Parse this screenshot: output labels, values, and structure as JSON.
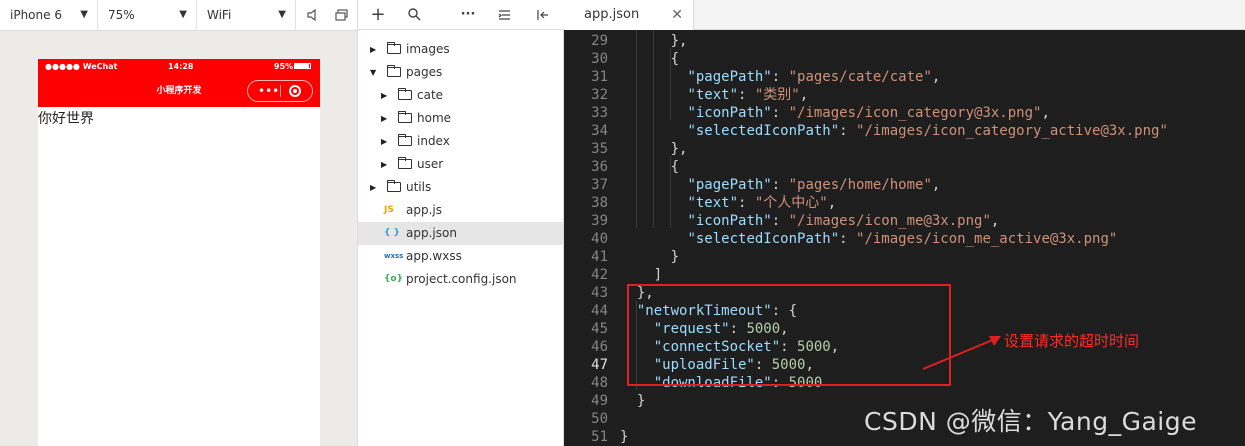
{
  "simulator": {
    "device": "iPhone 6",
    "zoom": "75%",
    "network": "WiFi",
    "status_carrier": "●●●●● WeChat",
    "status_time": "14:28",
    "status_battery": "95%",
    "battery_level": 0.95,
    "nav_title": "小程序开发",
    "page_text": "你好世界",
    "nav_color": "#ff0000"
  },
  "explorer": {
    "tree": [
      {
        "name": "images",
        "type": "folder",
        "expanded": false,
        "depth": 0
      },
      {
        "name": "pages",
        "type": "folder",
        "expanded": true,
        "depth": 0
      },
      {
        "name": "cate",
        "type": "folder",
        "expanded": false,
        "depth": 1
      },
      {
        "name": "home",
        "type": "folder",
        "expanded": false,
        "depth": 1
      },
      {
        "name": "index",
        "type": "folder",
        "expanded": false,
        "depth": 1
      },
      {
        "name": "user",
        "type": "folder",
        "expanded": false,
        "depth": 1
      },
      {
        "name": "utils",
        "type": "folder",
        "expanded": false,
        "depth": 0
      },
      {
        "name": "app.js",
        "type": "js",
        "icon": "JS",
        "depth": 0
      },
      {
        "name": "app.json",
        "type": "json",
        "icon": "{ }",
        "depth": 0,
        "active": true
      },
      {
        "name": "app.wxss",
        "type": "wxss",
        "icon": "wxss",
        "depth": 0
      },
      {
        "name": "project.config.json",
        "type": "config",
        "icon": "{o}",
        "depth": 0
      }
    ]
  },
  "editor": {
    "tab_label": "app.json",
    "current_line": 47,
    "lines": [
      {
        "n": 29,
        "tokens": [
          {
            "t": "p",
            "v": "      },"
          }
        ]
      },
      {
        "n": 30,
        "tokens": [
          {
            "t": "p",
            "v": "      {"
          }
        ]
      },
      {
        "n": 31,
        "tokens": [
          {
            "t": "p",
            "v": "        "
          },
          {
            "t": "k",
            "v": "\"pagePath\""
          },
          {
            "t": "p",
            "v": ": "
          },
          {
            "t": "s",
            "v": "\"pages/cate/cate\""
          },
          {
            "t": "p",
            "v": ","
          }
        ]
      },
      {
        "n": 32,
        "tokens": [
          {
            "t": "p",
            "v": "        "
          },
          {
            "t": "k",
            "v": "\"text\""
          },
          {
            "t": "p",
            "v": ": "
          },
          {
            "t": "s",
            "v": "\"类别\""
          },
          {
            "t": "p",
            "v": ","
          }
        ]
      },
      {
        "n": 33,
        "tokens": [
          {
            "t": "p",
            "v": "        "
          },
          {
            "t": "k",
            "v": "\"iconPath\""
          },
          {
            "t": "p",
            "v": ": "
          },
          {
            "t": "s",
            "v": "\"/images/icon_category@3x.png\""
          },
          {
            "t": "p",
            "v": ","
          }
        ]
      },
      {
        "n": 34,
        "tokens": [
          {
            "t": "p",
            "v": "        "
          },
          {
            "t": "k",
            "v": "\"selectedIconPath\""
          },
          {
            "t": "p",
            "v": ": "
          },
          {
            "t": "s",
            "v": "\"/images/icon_category_active@3x.png\""
          }
        ]
      },
      {
        "n": 35,
        "tokens": [
          {
            "t": "p",
            "v": "      },"
          }
        ]
      },
      {
        "n": 36,
        "tokens": [
          {
            "t": "p",
            "v": "      {"
          }
        ]
      },
      {
        "n": 37,
        "tokens": [
          {
            "t": "p",
            "v": "        "
          },
          {
            "t": "k",
            "v": "\"pagePath\""
          },
          {
            "t": "p",
            "v": ": "
          },
          {
            "t": "s",
            "v": "\"pages/home/home\""
          },
          {
            "t": "p",
            "v": ","
          }
        ]
      },
      {
        "n": 38,
        "tokens": [
          {
            "t": "p",
            "v": "        "
          },
          {
            "t": "k",
            "v": "\"text\""
          },
          {
            "t": "p",
            "v": ": "
          },
          {
            "t": "s",
            "v": "\"个人中心\""
          },
          {
            "t": "p",
            "v": ","
          }
        ]
      },
      {
        "n": 39,
        "tokens": [
          {
            "t": "p",
            "v": "        "
          },
          {
            "t": "k",
            "v": "\"iconPath\""
          },
          {
            "t": "p",
            "v": ": "
          },
          {
            "t": "s",
            "v": "\"/images/icon_me@3x.png\""
          },
          {
            "t": "p",
            "v": ","
          }
        ]
      },
      {
        "n": 40,
        "tokens": [
          {
            "t": "p",
            "v": "        "
          },
          {
            "t": "k",
            "v": "\"selectedIconPath\""
          },
          {
            "t": "p",
            "v": ": "
          },
          {
            "t": "s",
            "v": "\"/images/icon_me_active@3x.png\""
          }
        ]
      },
      {
        "n": 41,
        "tokens": [
          {
            "t": "p",
            "v": "      }"
          }
        ]
      },
      {
        "n": 42,
        "tokens": [
          {
            "t": "p",
            "v": "    ]"
          }
        ]
      },
      {
        "n": 43,
        "tokens": [
          {
            "t": "p",
            "v": "  },"
          }
        ]
      },
      {
        "n": 44,
        "tokens": [
          {
            "t": "p",
            "v": "  "
          },
          {
            "t": "k",
            "v": "\"networkTimeout\""
          },
          {
            "t": "p",
            "v": ": {"
          }
        ]
      },
      {
        "n": 45,
        "tokens": [
          {
            "t": "p",
            "v": "    "
          },
          {
            "t": "k",
            "v": "\"request\""
          },
          {
            "t": "p",
            "v": ": "
          },
          {
            "t": "n",
            "v": "5000"
          },
          {
            "t": "p",
            "v": ","
          }
        ]
      },
      {
        "n": 46,
        "tokens": [
          {
            "t": "p",
            "v": "    "
          },
          {
            "t": "k",
            "v": "\"connectSocket\""
          },
          {
            "t": "p",
            "v": ": "
          },
          {
            "t": "n",
            "v": "5000"
          },
          {
            "t": "p",
            "v": ","
          }
        ]
      },
      {
        "n": 47,
        "tokens": [
          {
            "t": "p",
            "v": "    "
          },
          {
            "t": "k",
            "v": "\"uploadFile\""
          },
          {
            "t": "p",
            "v": ": "
          },
          {
            "t": "n",
            "v": "5000"
          },
          {
            "t": "p",
            "v": ","
          }
        ]
      },
      {
        "n": 48,
        "tokens": [
          {
            "t": "p",
            "v": "    "
          },
          {
            "t": "k",
            "v": "\"downloadFile\""
          },
          {
            "t": "p",
            "v": ": "
          },
          {
            "t": "n",
            "v": "5000"
          }
        ]
      },
      {
        "n": 49,
        "tokens": [
          {
            "t": "p",
            "v": "  }"
          }
        ]
      },
      {
        "n": 50,
        "tokens": []
      },
      {
        "n": 51,
        "tokens": [
          {
            "t": "p",
            "v": "}"
          }
        ]
      }
    ]
  },
  "annotation": {
    "text": "设置请求的超时时间",
    "color": "#e02020"
  },
  "watermark": "CSDN @微信：Yang_Gaige"
}
